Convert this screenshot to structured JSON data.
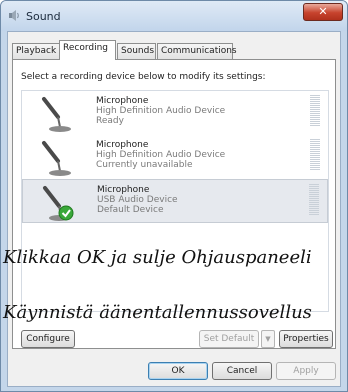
{
  "window": {
    "title": "Sound",
    "close_glyph": "✕"
  },
  "tabs": [
    {
      "label": "Playback"
    },
    {
      "label": "Recording"
    },
    {
      "label": "Sounds"
    },
    {
      "label": "Communications"
    }
  ],
  "instruction": "Select a recording device below to modify its settings:",
  "devices": [
    {
      "name": "Microphone",
      "line1": "High Definition Audio Device",
      "line2": "Ready",
      "icon": "microphone-icon"
    },
    {
      "name": "Microphone",
      "line1": "High Definition Audio Device",
      "line2": "Currently unavailable",
      "icon": "microphone-icon"
    },
    {
      "name": "Microphone",
      "line1": "USB Audio Device",
      "line2": "Default Device",
      "icon": "microphone-default-check-icon",
      "selected": true
    }
  ],
  "overlay": {
    "line1": "Klikkaa OK ja sulje Ohjauspaneeli",
    "line2": "Käynnistä äänentallennussovellus"
  },
  "buttons": {
    "configure": "Configure",
    "set_default": "Set Default",
    "dropdown_glyph": "▼",
    "properties": "Properties",
    "ok": "OK",
    "cancel": "Cancel",
    "apply": "Apply"
  },
  "colors": {
    "selected_bg": "#e6e9ee",
    "check_green": "#3aa83a",
    "titlebar": "#c4d6ea"
  }
}
